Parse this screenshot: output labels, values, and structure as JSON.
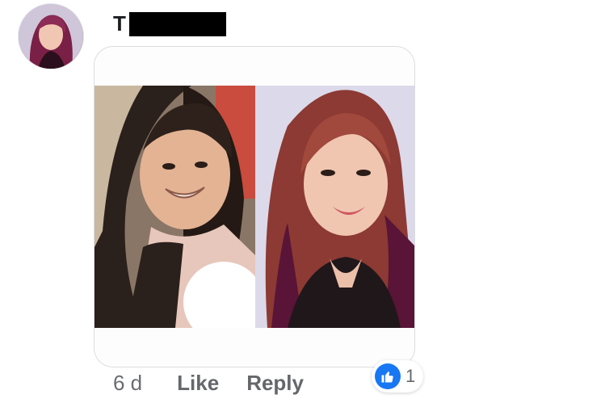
{
  "comment": {
    "author_visible": "T",
    "time": "6 d",
    "like_label": "Like",
    "reply_label": "Reply",
    "reaction_count": "1",
    "reaction_icon": "thumbs-up-icon",
    "colors": {
      "like_blue": "#1877f2",
      "meta_gray": "#65676b"
    }
  }
}
